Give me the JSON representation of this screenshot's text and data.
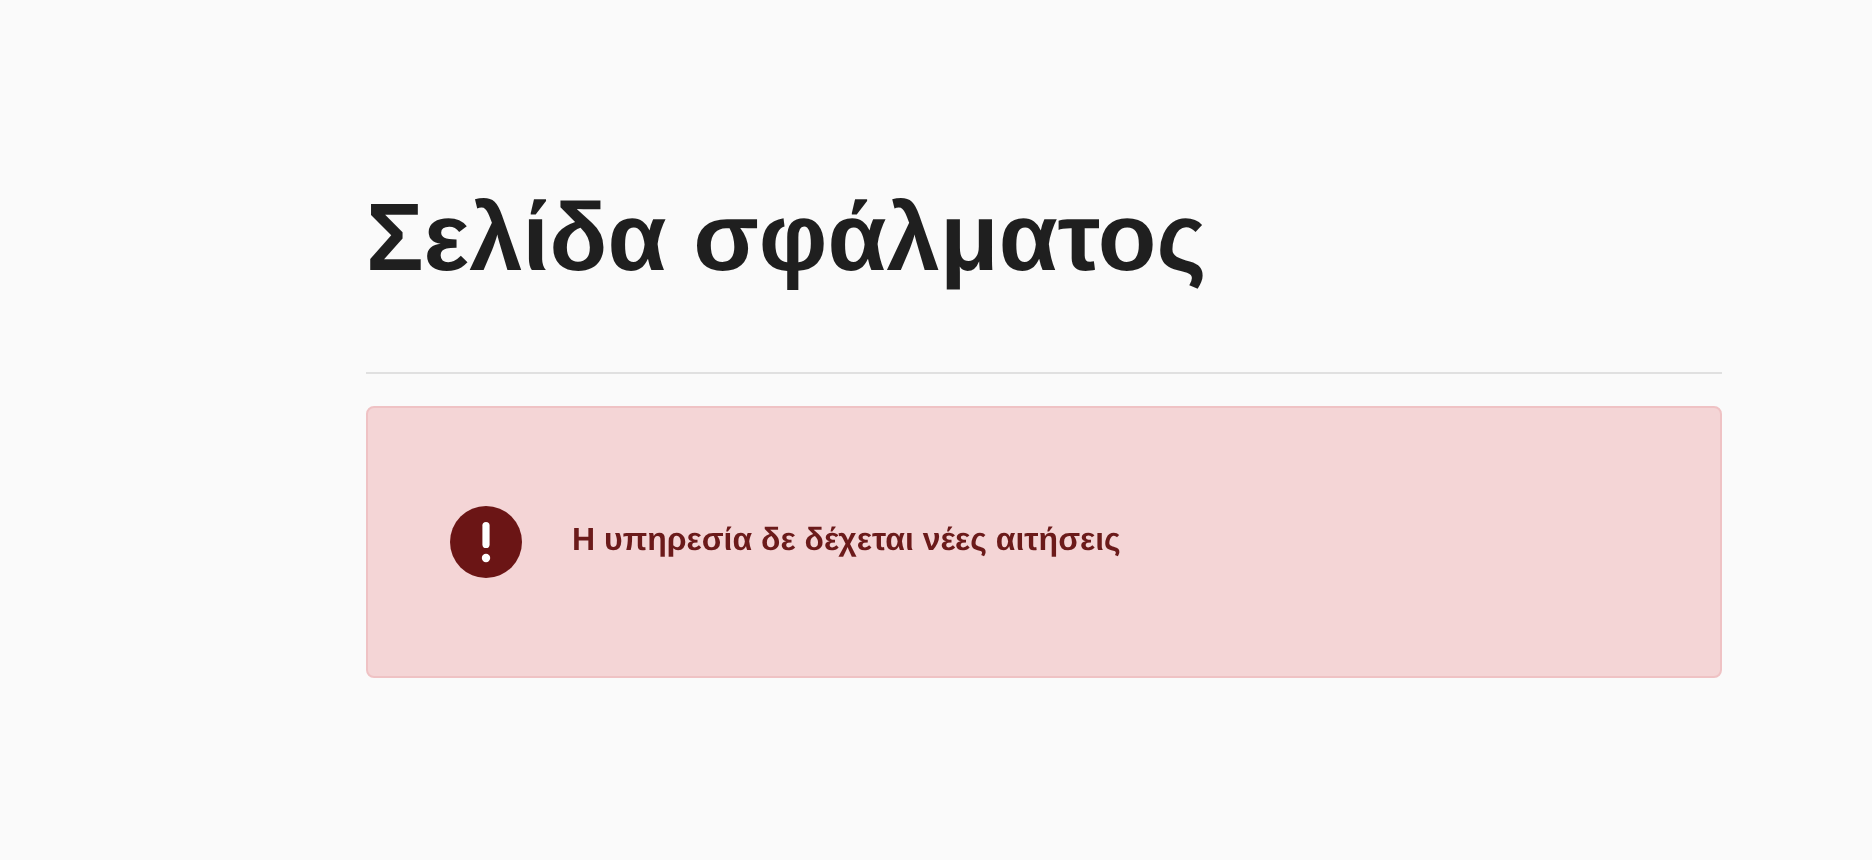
{
  "title": "Σελίδα σφάλματος",
  "alert": {
    "kind": "error",
    "message": "Η υπηρεσία δε δέχεται νέες αιτήσεις"
  }
}
